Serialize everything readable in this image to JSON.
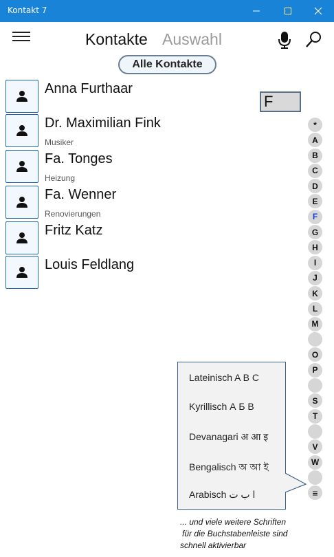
{
  "window": {
    "title": "Kontakt 7"
  },
  "header": {
    "tab_main": "Kontakte",
    "tab_alt": "Auswahl",
    "filter_pill": "Alle Kontakte"
  },
  "contacts": [
    {
      "name": "Anna Furthaar",
      "subtitle": ""
    },
    {
      "name": "Dr. Maximilian Fink",
      "subtitle": "Musiker"
    },
    {
      "name": "Fa. Tonges",
      "subtitle": "Heizung"
    },
    {
      "name": "Fa. Wenner",
      "subtitle": "Renovierungen"
    },
    {
      "name": "Fritz Katz",
      "subtitle": ""
    },
    {
      "name": "Louis Feldlang",
      "subtitle": ""
    }
  ],
  "letter_indicator": "F",
  "alphabet": [
    "*",
    "A",
    "B",
    "C",
    "D",
    "E",
    "F",
    "G",
    "H",
    "I",
    "J",
    "K",
    "L",
    "M",
    "",
    "O",
    "P",
    "",
    "S",
    "T",
    "",
    "V",
    "W",
    "",
    "≡"
  ],
  "alphabet_active": "F",
  "script_menu": [
    "Lateinisch  A B C",
    "Kyrillisch  А Б В",
    "Devanagari  अ आ इ",
    "Bengalisch  অ আ ই",
    "Arabisch  ا ب ت"
  ],
  "caption": [
    "... und viele weitere Schriften",
    "für die Buchstabenleiste sind",
    "schnell aktivierbar"
  ],
  "colors": {
    "titlebar": "#1883d7",
    "avatar_border": "#1f63a8",
    "active_letter": "#1a3ccf"
  }
}
